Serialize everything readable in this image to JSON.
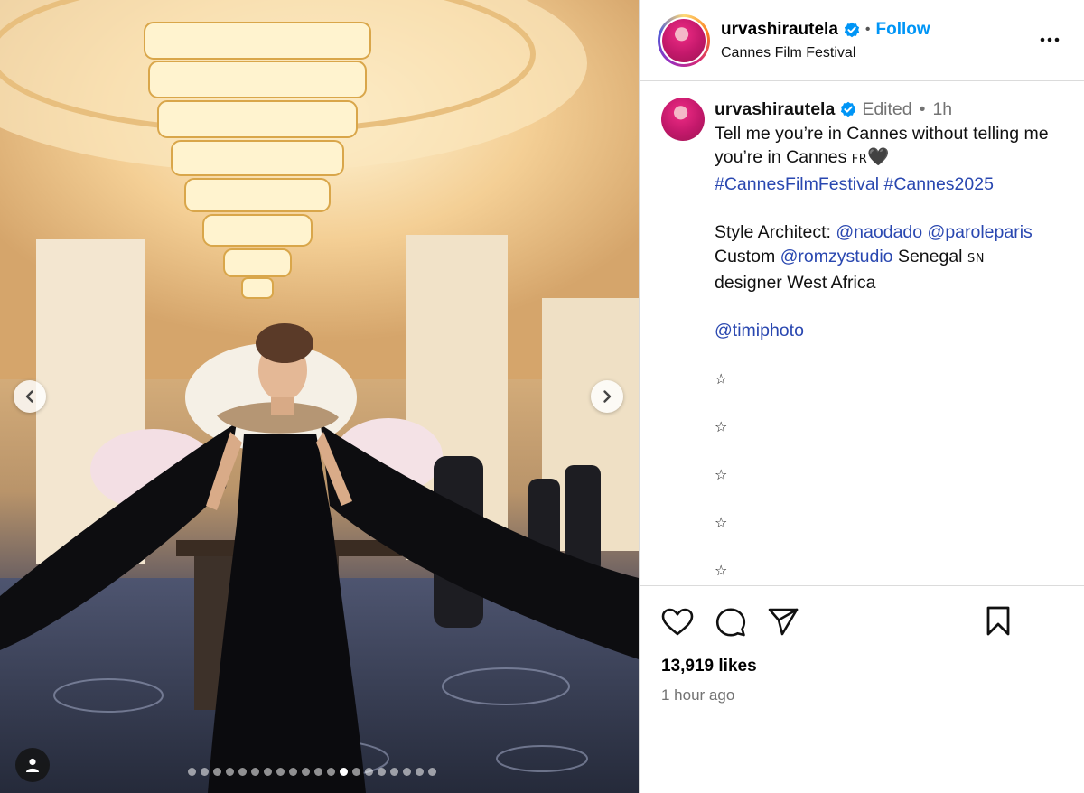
{
  "header": {
    "username": "urvashirautela",
    "separator": "•",
    "follow_label": "Follow",
    "location": "Cannes Film Festival"
  },
  "caption": {
    "username": "urvashirautela",
    "edited": "Edited",
    "separator": "•",
    "age": "1h",
    "line1": "Tell me you’re in Cannes without telling me you’re in Cannes",
    "flag": "FR",
    "heart": "🖤",
    "hashtag1": "#CannesFilmFestival",
    "hashtag2": "#Cannes2025",
    "style_prefix": "Style Architect:",
    "mention1": "@naodado",
    "mention2": "@paroleparis",
    "custom_prefix": "Custom",
    "mention3": "@romzystudio",
    "custom_suffix": "Senegal",
    "flag2": "SN",
    "designer": "designer West Africa",
    "photo_mention": "@timiphoto",
    "stars": [
      "☆",
      "☆",
      "☆",
      "☆",
      "☆"
    ]
  },
  "actions": {
    "likes": "13,919 likes",
    "time": "1 hour ago"
  },
  "carousel": {
    "total_slides": 20,
    "active_index": 12
  },
  "colors": {
    "follow": "#0095f6",
    "link": "#2947b0",
    "verified": "#0095f6",
    "muted": "#737373"
  },
  "icons": {
    "verified": "verified-badge-icon",
    "more": "more-options-icon",
    "like": "heart-icon",
    "comment": "comment-icon",
    "share": "share-icon",
    "save": "bookmark-icon",
    "prev": "chevron-left-icon",
    "next": "chevron-right-icon",
    "tag": "user-tag-icon"
  }
}
